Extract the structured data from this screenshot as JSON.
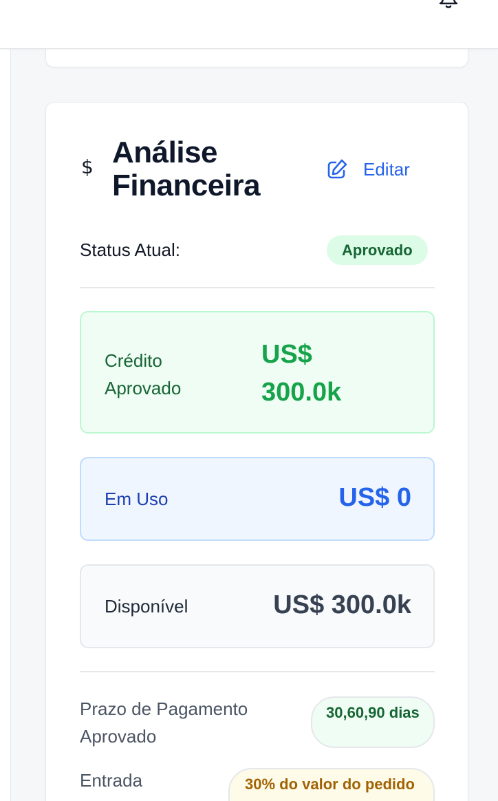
{
  "header": {
    "notifications_icon": "bell-icon"
  },
  "card": {
    "icon": "dollar-icon",
    "icon_glyph": "$",
    "title": "Análise Financeira",
    "edit_label": "Editar",
    "status_label": "Status Atual:",
    "status_value": "Aprovado",
    "credit_approved_label": "Crédito Aprovado",
    "credit_approved_value": "US$ 300.0k",
    "in_use_label": "Em Uso",
    "in_use_value": "US$ 0",
    "available_label": "Disponível",
    "available_value": "US$ 300.0k",
    "payment_term_label": "Prazo de Pagamento Aprovado",
    "payment_term_value": "30,60,90 dias",
    "down_payment_label": "Entrada Requerida",
    "down_payment_value": "30% do valor do pedido"
  },
  "colors": {
    "accent": "#2563eb",
    "success": "#16a34a",
    "success_bg": "#f0fdf4",
    "info_bg": "#eff6ff",
    "warning_text": "#a16207",
    "warning_bg": "#fefce8"
  }
}
